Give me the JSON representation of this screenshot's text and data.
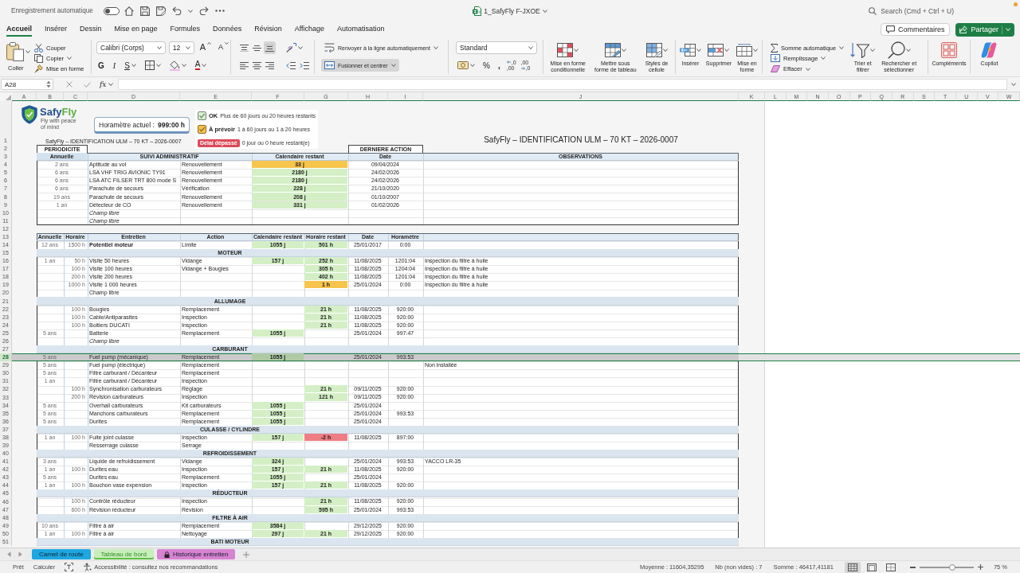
{
  "title_bar": {
    "autosave_label": "Enregistrement automatique",
    "autosave_on": false,
    "file_name": "1_SafyFly F-JXOE",
    "search_placeholder": "Search (Cmd + Ctrl + U)"
  },
  "ribbon_tabs": [
    {
      "label": "Accueil",
      "selected": true
    },
    {
      "label": "Insérer",
      "selected": false
    },
    {
      "label": "Dessin",
      "selected": false
    },
    {
      "label": "Mise en page",
      "selected": false
    },
    {
      "label": "Formules",
      "selected": false
    },
    {
      "label": "Données",
      "selected": false
    },
    {
      "label": "Révision",
      "selected": false
    },
    {
      "label": "Affichage",
      "selected": false
    },
    {
      "label": "Automatisation",
      "selected": false
    }
  ],
  "header_buttons": {
    "comments": "Commentaires",
    "share": "Partager"
  },
  "ribbon": {
    "clipboard": {
      "paste": "Coller",
      "cut": "Couper",
      "copy": "Copier",
      "format_painter": "Mise en forme"
    },
    "font": {
      "family": "Calibri (Corps)",
      "size": "12",
      "grow": "A",
      "shrink": "A",
      "bold": "G",
      "italic": "I",
      "underline": "S",
      "color_letter": "A"
    },
    "alignment": {
      "vertical": [
        {
          "kind": "top",
          "on": false
        },
        {
          "kind": "middle",
          "on": false
        },
        {
          "kind": "bottom",
          "on": true
        }
      ],
      "horizontal": [
        {
          "kind": "left",
          "on": false
        },
        {
          "kind": "center",
          "on": false
        },
        {
          "kind": "right",
          "on": false
        }
      ]
    },
    "wrap": {
      "label": "Renvoyer à la ligne automatiquement",
      "on": false
    },
    "merge": {
      "label": "Fusionner et centrer",
      "on": true
    },
    "number": {
      "format": "Standard",
      "percent": "%",
      "thousands": ",",
      "decimals": [
        {
          "kind": "increase",
          "top": ",0",
          "bottom": ",00"
        },
        {
          "kind": "decrease",
          "top": ",00",
          "bottom": ",0"
        }
      ]
    },
    "styles": [
      {
        "kind": "conditional",
        "label": "Mise en forme\nconditionnelle"
      },
      {
        "kind": "table",
        "label": "Mettre sous\nforme de tableau"
      },
      {
        "kind": "cell",
        "label": "Styles de\ncellule"
      }
    ],
    "cells": [
      {
        "kind": "insert",
        "label": "Insérer"
      },
      {
        "kind": "delete",
        "label": "Supprimer"
      },
      {
        "kind": "format",
        "label": "Mise en\nforme"
      }
    ],
    "editing": {
      "autosum": "Somme automatique",
      "fill": "Remplissage",
      "clear": "Effacer",
      "sort": "Trier et\nfiltrer",
      "find": "Rechercher et\nsélectionner"
    },
    "addins": "Compléments",
    "copilot": "Copilot"
  },
  "formula_bar": {
    "cell": "A28",
    "fx": "fx"
  },
  "sheet": {
    "columns": [
      "A",
      "B",
      "C",
      "D",
      "E",
      "F",
      "G",
      "H",
      "I",
      "J",
      "K",
      "L",
      "M",
      "N",
      "O",
      "P",
      "Q",
      "R",
      "S",
      "T",
      "U",
      "V",
      "W"
    ],
    "logo": {
      "brand": [
        "Safy",
        "Fly"
      ],
      "tagline": "Fly with peace of mind"
    },
    "hour_meter": {
      "label": "Horamètre actuel :",
      "value": "999:00 h"
    },
    "legend": [
      {
        "kind": "check",
        "color": "#d8f1cf",
        "label": "OK",
        "note": "Plus de 60 jours ou 20 heures restants"
      },
      {
        "kind": "check",
        "color": "#f7c24a",
        "label": "À prévoir",
        "note": "1 à 60 jours ou 1 à 20 heures"
      },
      {
        "kind": "badge",
        "color": "#dc4a5a",
        "label": "Délai dépassé",
        "note": "0 jour ou 0 heure restant(e)"
      }
    ],
    "rows": [
      {
        "number": "1",
        "selected": false,
        "kind": "title",
        "caption": "SafyFly – IDENTIFICATION ULM – 70 KT – 2026-0007",
        "banner": "SafyFly – IDENTIFICATION ULM – 70 KT – 2026-0007"
      },
      {
        "number": "2",
        "selected": false,
        "kind": "tabs",
        "left": "PERIODICITE",
        "right": "DERNIERE ACTION"
      },
      {
        "number": "3",
        "selected": false,
        "kind": "admin_header",
        "annual": "Annuelle",
        "item": "SUIVI ADMINISTRATIF",
        "days": "Calendaire restant",
        "date": "Date",
        "note": "OBSERVATIONS"
      },
      {
        "number": "4",
        "selected": false,
        "kind": "admin",
        "annual": "2 ans",
        "item": "Aptitude au vol",
        "action": "Renouvellement",
        "days": {
          "text": "33 j",
          "color": "#f7c44c"
        },
        "date": "09/04/2024"
      },
      {
        "number": "5",
        "selected": false,
        "kind": "admin",
        "annual": "6 ans",
        "item": "LSA VHF TRIG AVIONIC TY91",
        "action": "Renouvellement",
        "days": {
          "text": "2180 j",
          "color": "#d4efc6"
        },
        "date": "24/02/2026"
      },
      {
        "number": "6",
        "selected": false,
        "kind": "admin",
        "annual": "6 ans",
        "item": "LSA ATC FILSER TRT 800 mode S",
        "action": "Renouvellement",
        "days": {
          "text": "2180 j",
          "color": "#d4efc6"
        },
        "date": "24/02/2026"
      },
      {
        "number": "7",
        "selected": false,
        "kind": "admin",
        "annual": "6 ans",
        "item": "Parachute de secours",
        "action": "Vérification",
        "days": {
          "text": "228 j",
          "color": "#d4efc6"
        },
        "date": "21/10/2020"
      },
      {
        "number": "8",
        "selected": false,
        "kind": "admin",
        "annual": "19 ans",
        "item": "Parachute de secours",
        "action": "Renouvellement",
        "days": {
          "text": "208 j",
          "color": "#d4efc6"
        },
        "date": "01/10/2007"
      },
      {
        "number": "9",
        "selected": false,
        "kind": "admin",
        "annual": "1 an",
        "item": "Détecteur de CO",
        "action": "Renouvellement",
        "days": {
          "text": "331 j",
          "color": "#d4efc6"
        },
        "date": "01/02/2026"
      },
      {
        "number": "10",
        "selected": false,
        "kind": "admin_free",
        "item": "Champ libre"
      },
      {
        "number": "11",
        "selected": false,
        "kind": "admin_free",
        "item": "Champ libre"
      },
      {
        "number": "12",
        "selected": false,
        "kind": "gap"
      },
      {
        "number": "13",
        "selected": false,
        "kind": "header",
        "annual": "Annuelle",
        "hours": "Horaire",
        "item": "Entretien",
        "action": "Action",
        "days": "Calendaire restant",
        "hours_left": "Horaire restant",
        "date": "Date",
        "meter": "Horamètre"
      },
      {
        "number": "14",
        "selected": false,
        "kind": "item_limit",
        "annual": "12 ans",
        "hours": "1500 h",
        "item": "Potentiel moteur",
        "action": "Limite",
        "days": {
          "text": "1055 j",
          "color": "#d4efc6"
        },
        "hours_left": {
          "text": "501 h",
          "color": "#d4efc6"
        },
        "date": "25/01/2017",
        "meter": "0:00"
      },
      {
        "number": "15",
        "selected": false,
        "kind": "section",
        "title": "MOTEUR"
      },
      {
        "number": "16",
        "selected": false,
        "kind": "item",
        "annual": "1 an",
        "hours": "50 h",
        "item": "Visite 50 heures",
        "action": "Vidange",
        "days": {
          "text": "157 j",
          "color": "#d4efc6"
        },
        "hours_left": {
          "text": "252 h",
          "color": "#d4efc6"
        },
        "date": "11/08/2025",
        "meter": "1201:04",
        "note": "Inspection du filtre à huile"
      },
      {
        "number": "17",
        "selected": false,
        "kind": "item",
        "hours": "100 h",
        "item": "Visite 100 heures",
        "action": "Vidange + Bougies",
        "hours_left": {
          "text": "305 h",
          "color": "#d4efc6"
        },
        "date": "11/08/2025",
        "meter": "1204:04",
        "note": "Inspection du filtre à huile"
      },
      {
        "number": "18",
        "selected": false,
        "kind": "item",
        "hours": "200 h",
        "item": "Visite 200 heures",
        "hours_left": {
          "text": "402 h",
          "color": "#d4efc6"
        },
        "date": "11/08/2025",
        "meter": "1201:04",
        "note": "Inspection du filtre à huile"
      },
      {
        "number": "19",
        "selected": false,
        "kind": "item",
        "hours": "1000 h",
        "item": "Visite 1 000 heures",
        "hours_left": {
          "text": "1 h",
          "color": "#f7c44c"
        },
        "date": "25/01/2024",
        "meter": "0:00",
        "note": "Inspection du filtre à huile"
      },
      {
        "number": "20",
        "selected": false,
        "kind": "item",
        "item": "Champ libre"
      },
      {
        "number": "21",
        "selected": false,
        "kind": "section",
        "title": "ALLUMAGE"
      },
      {
        "number": "22",
        "selected": false,
        "kind": "item",
        "hours": "100 h",
        "item": "Bougies",
        "action": "Remplacement",
        "hours_left": {
          "text": "21 h",
          "color": "#d4efc6"
        },
        "date": "11/08/2025",
        "meter": "920:00"
      },
      {
        "number": "23",
        "selected": false,
        "kind": "item",
        "hours": "100 h",
        "item": "Cable/Antiparasites",
        "action": "Inspection",
        "hours_left": {
          "text": "21 h",
          "color": "#d4efc6"
        },
        "date": "11/08/2025",
        "meter": "920:00"
      },
      {
        "number": "24",
        "selected": false,
        "kind": "item",
        "hours": "100 h",
        "item": "Boitiers DUCATI",
        "action": "Inspection",
        "hours_left": {
          "text": "21 h",
          "color": "#d4efc6"
        },
        "date": "11/08/2025",
        "meter": "920:00"
      },
      {
        "number": "25",
        "selected": false,
        "kind": "item",
        "annual": "5 ans",
        "item": "Batterie",
        "action": "Remplacement",
        "days": {
          "text": "1055 j",
          "color": "#d4efc6"
        },
        "date": "25/01/2024",
        "meter": "997:47"
      },
      {
        "number": "26",
        "selected": false,
        "kind": "item_free",
        "item": "Champ libre"
      },
      {
        "number": "27",
        "selected": false,
        "kind": "section",
        "title": "CARBURANT"
      },
      {
        "number": "28",
        "selected": true,
        "kind": "item",
        "annual": "5 ans",
        "item": "Fuel pump (mécanique)",
        "action": "Remplacement",
        "days": {
          "text": "1055 j",
          "color": "#aecaa4"
        },
        "date": "25/01/2024",
        "meter": "993:53"
      },
      {
        "number": "29",
        "selected": false,
        "kind": "item",
        "annual": "5 ans",
        "item": "Fuel pump (électrique)",
        "action": "Remplacement",
        "note": "Non installée"
      },
      {
        "number": "30",
        "selected": false,
        "kind": "item",
        "annual": "5 ans",
        "item": "Filtre carburant / Décanteur",
        "action": "Remplacement"
      },
      {
        "number": "31",
        "selected": false,
        "kind": "item",
        "annual": "1 an",
        "item": "Filtre carburant / Décanteur",
        "action": "Inspection"
      },
      {
        "number": "32",
        "selected": false,
        "kind": "item",
        "hours": "100 h",
        "item": "Synchronisation carburateurs",
        "action": "Réglage",
        "hours_left": {
          "text": "21 h",
          "color": "#d4efc6"
        },
        "date": "09/11/2025",
        "meter": "920:00"
      },
      {
        "number": "33",
        "selected": false,
        "kind": "item",
        "hours": "200 h",
        "item": "Révision carburateurs",
        "action": "Inspection",
        "hours_left": {
          "text": "121 h",
          "color": "#d4efc6"
        },
        "date": "09/11/2025",
        "meter": "920:00"
      },
      {
        "number": "34",
        "selected": false,
        "kind": "item",
        "annual": "5 ans",
        "item": "Overhall carburateurs",
        "action": "Kit carburateurs",
        "days": {
          "text": "1055 j",
          "color": "#d4efc6"
        },
        "date": "25/01/2024"
      },
      {
        "number": "35",
        "selected": false,
        "kind": "item",
        "annual": "5 ans",
        "item": "Manchons carburateurs",
        "action": "Remplacement",
        "days": {
          "text": "1055 j",
          "color": "#d4efc6"
        },
        "date": "25/01/2024",
        "meter": "993:53"
      },
      {
        "number": "36",
        "selected": false,
        "kind": "item",
        "annual": "5 ans",
        "item": "Durites",
        "action": "Remplacement",
        "days": {
          "text": "1055 j",
          "color": "#d4efc6"
        },
        "date": "25/01/2024"
      },
      {
        "number": "37",
        "selected": false,
        "kind": "section",
        "title": "CULASSE / CYLINDRE"
      },
      {
        "number": "38",
        "selected": false,
        "kind": "item",
        "annual": "1 an",
        "hours": "100 h",
        "item": "Fuite joint culasse",
        "action": "Inspection",
        "days": {
          "text": "157 j",
          "color": "#d4efc6"
        },
        "hours_left": {
          "text": "-2 h",
          "color": "#ef7d84"
        },
        "date": "11/08/2025",
        "meter": "897:00"
      },
      {
        "number": "39",
        "selected": false,
        "kind": "item",
        "item": "Resserrage culasse",
        "action": "Serrage"
      },
      {
        "number": "40",
        "selected": false,
        "kind": "section",
        "title": "REFROIDISSEMENT"
      },
      {
        "number": "41",
        "selected": false,
        "kind": "item",
        "annual": "3 ans",
        "item": "Liquide de refroidissement",
        "action": "Vidange",
        "days": {
          "text": "324 j",
          "color": "#d4efc6"
        },
        "date": "25/01/2024",
        "meter": "993:53",
        "note": "YACCO LR-35"
      },
      {
        "number": "42",
        "selected": false,
        "kind": "item",
        "annual": "1 an",
        "hours": "100 h",
        "item": "Durites eau",
        "action": "Inspection",
        "days": {
          "text": "157 j",
          "color": "#d4efc6"
        },
        "hours_left": {
          "text": "21 h",
          "color": "#d4efc6"
        },
        "date": "11/08/2025",
        "meter": "920:00"
      },
      {
        "number": "43",
        "selected": false,
        "kind": "item",
        "annual": "5 ans",
        "item": "Durites eau",
        "action": "Remplacement",
        "days": {
          "text": "1055 j",
          "color": "#d4efc6"
        },
        "date": "25/01/2024"
      },
      {
        "number": "44",
        "selected": false,
        "kind": "item",
        "annual": "1 an",
        "hours": "100 h",
        "item": "Bouchon vase expension",
        "action": "Inspection",
        "days": {
          "text": "157 j",
          "color": "#d4efc6"
        },
        "hours_left": {
          "text": "21 h",
          "color": "#d4efc6"
        },
        "date": "11/08/2025",
        "meter": "920:00"
      },
      {
        "number": "45",
        "selected": false,
        "kind": "section",
        "title": "RÉDUCTEUR"
      },
      {
        "number": "46",
        "selected": false,
        "kind": "item",
        "hours": "100 h",
        "item": "Contrôle réducteur",
        "action": "Inspection",
        "hours_left": {
          "text": "21 h",
          "color": "#d4efc6"
        },
        "date": "11/08/2025",
        "meter": "920:00"
      },
      {
        "number": "47",
        "selected": false,
        "kind": "item",
        "hours": "600 h",
        "item": "Révision réducteur",
        "action": "Révision",
        "hours_left": {
          "text": "595 h",
          "color": "#d4efc6"
        },
        "date": "25/01/2024",
        "meter": "993:53"
      },
      {
        "number": "48",
        "selected": false,
        "kind": "section",
        "title": "FILTRE À AIR"
      },
      {
        "number": "49",
        "selected": false,
        "kind": "item",
        "annual": "10 ans",
        "item": "Filtre à air",
        "action": "Remplacement",
        "days": {
          "text": "3584 j",
          "color": "#d4efc6"
        },
        "date": "29/12/2025",
        "meter": "920:00"
      },
      {
        "number": "50",
        "selected": false,
        "kind": "item",
        "annual": "1 an",
        "hours": "100 h",
        "item": "Filtre à air",
        "action": "Nettoyage",
        "days": {
          "text": "297 j",
          "color": "#d4efc6"
        },
        "hours_left": {
          "text": "21 h",
          "color": "#d4efc6"
        },
        "date": "29/12/2025",
        "meter": "920:00"
      },
      {
        "number": "51",
        "selected": false,
        "kind": "section",
        "title": "BATI MOTEUR"
      }
    ]
  },
  "sheet_tabs": [
    {
      "label": "Carnet de route",
      "color": "#1ea7e1",
      "selected": false,
      "locked": false
    },
    {
      "label": "Tableau de bord",
      "color": "#c8eebb",
      "selected": true,
      "locked": false
    },
    {
      "label": "Historique entretien",
      "color": "#d882d2",
      "selected": false,
      "locked": true
    }
  ],
  "status_bar": {
    "mode": "Prêt",
    "calculate": "Calculer",
    "accessibility": "Accessibilité : consultez nos recommandations",
    "average": "Moyenne : 11604,35295",
    "count": "Nb (non vides) : 7",
    "sum": "Somme : 46417,41181",
    "views": [
      {
        "kind": "normal",
        "selected": true
      },
      {
        "kind": "page_layout",
        "selected": false
      },
      {
        "kind": "page_break",
        "selected": false
      }
    ],
    "zoom": {
      "level": 0.62,
      "label": "75 %"
    }
  }
}
